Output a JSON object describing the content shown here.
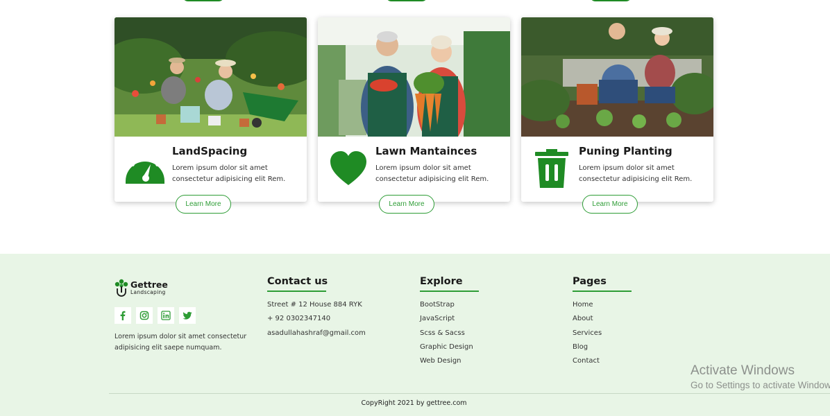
{
  "cards": [
    {
      "title": "LandSpacing",
      "text": "Lorem ipsum dolor sit amet consectetur adipisicing elit Rem.",
      "button": "Learn More",
      "icon": "speedometer-icon",
      "image": "couple-gardening-wheelbarrow-photo"
    },
    {
      "title": "Lawn Mantainces",
      "text": "Lorem ipsum dolor sit amet consectetur adipisicing elit Rem.",
      "button": "Learn More",
      "icon": "heart-icon",
      "image": "couple-holding-vegetables-photo"
    },
    {
      "title": "Puning Planting",
      "text": "Lorem ipsum dolor sit amet consectetur adipisicing elit Rem.",
      "button": "Learn More",
      "icon": "trash-icon",
      "image": "couple-planting-garden-photo"
    }
  ],
  "footer": {
    "brand": {
      "name": "Gettree",
      "sub": "Landscaping"
    },
    "socials": [
      "facebook-icon",
      "instagram-icon",
      "linkedin-icon",
      "twitter-icon"
    ],
    "about": "Lorem ipsum dolor sit amet consectetur adipisicing elit saepe numquam.",
    "contact": {
      "title": "Contact us",
      "items": [
        "Street # 12 House 884 RYK",
        "+ 92 0302347140",
        "asadullahashraf@gmail.com"
      ]
    },
    "explore": {
      "title": "Explore",
      "items": [
        "BootStrap",
        "JavaScript",
        "Scss & Sacss",
        "Graphic Design",
        "Web Design"
      ]
    },
    "pages": {
      "title": "Pages",
      "items": [
        "Home",
        "About",
        "Services",
        "Blog",
        "Contact"
      ]
    },
    "copyright": "CopyRight 2021 by gettree.com"
  },
  "watermark": {
    "line1": "Activate Windows",
    "line2": "Go to Settings to activate Windows."
  },
  "colors": {
    "accent": "#2d9c35",
    "icon_green": "#1f8b24",
    "footer_bg": "#e8f5e6"
  }
}
